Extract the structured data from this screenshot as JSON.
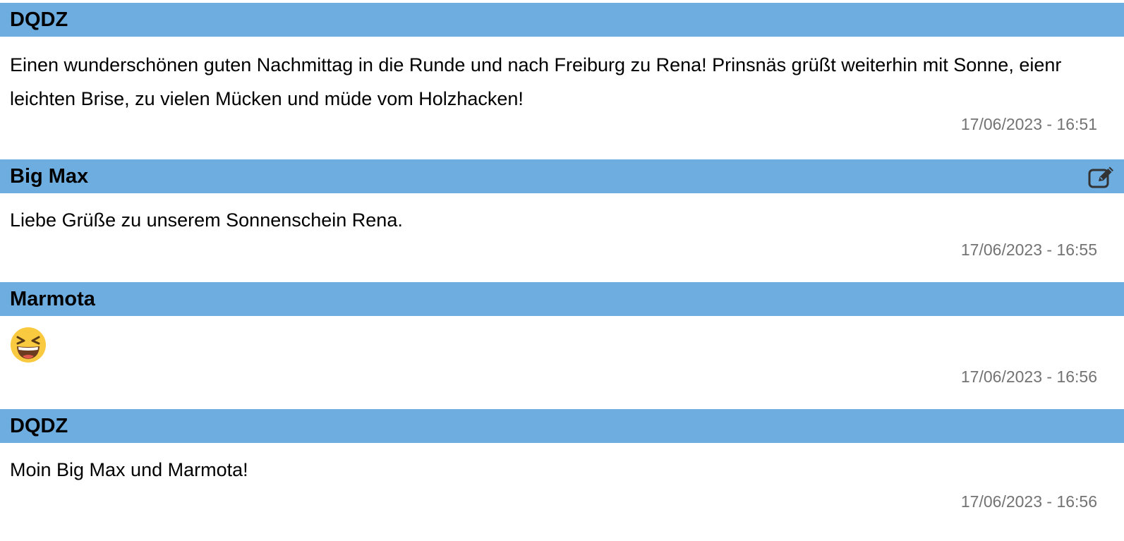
{
  "posts": [
    {
      "author": "DQDZ",
      "message": "Einen wunderschönen guten Nachmittag in die Runde und nach Freiburg zu Rena! Prinsnäs grüßt weiterhin mit Sonne, eienr leichten Brise, zu vielen Mücken und müde vom Holzhacken!",
      "timestamp": "17/06/2023 - 16:51",
      "has_edit_icon": false
    },
    {
      "author": "Big Max",
      "message": "Liebe Grüße zu unserem Sonnenschein Rena.",
      "timestamp": "17/06/2023 - 16:55",
      "has_edit_icon": true,
      "edit_icon": "edit-icon"
    },
    {
      "author": "Marmota",
      "message_icon": "laughing-face-emoji-icon",
      "timestamp": "17/06/2023 - 16:56",
      "has_edit_icon": false
    },
    {
      "author": "DQDZ",
      "message": "Moin Big Max und Marmota!",
      "timestamp": "17/06/2023 - 16:56",
      "has_edit_icon": false
    }
  ],
  "colors": {
    "header_background": "#6eade0",
    "timestamp_text": "#737373",
    "emoji_face": "#f9c940"
  }
}
